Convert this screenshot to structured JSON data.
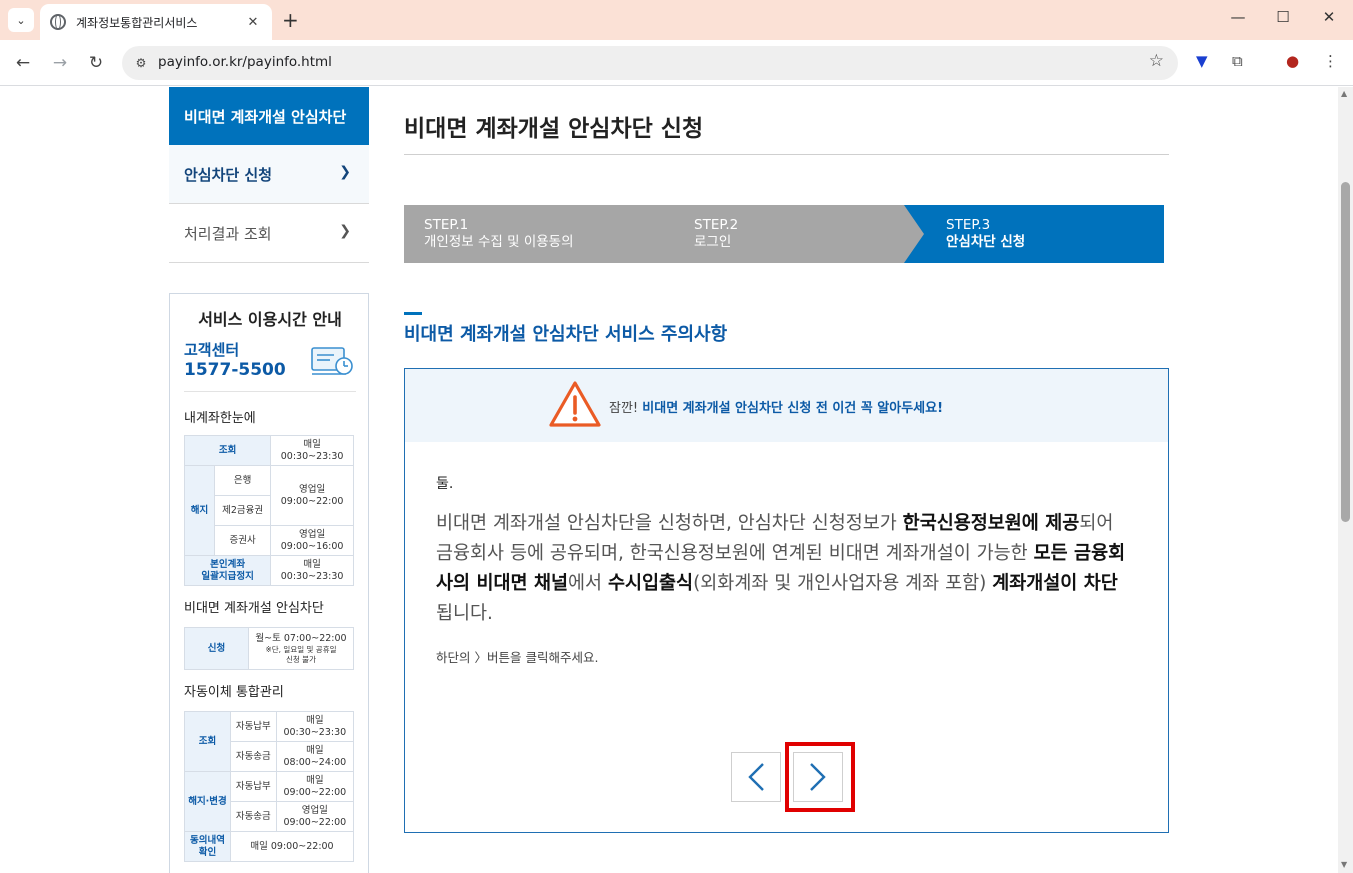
{
  "browser": {
    "tab_title": "계좌정보통합관리서비스",
    "url": "payinfo.or.kr/payinfo.html"
  },
  "sidebar": {
    "header": "비대면 계좌개설 안심차단",
    "items": [
      {
        "label": "안심차단 신청",
        "active": true
      },
      {
        "label": "처리결과 조회",
        "active": false
      }
    ]
  },
  "service_info": {
    "title": "서비스 이용시간 안내",
    "call_center_label": "고객센터",
    "call_center_phone": "1577-5500",
    "sections": [
      {
        "title": "내계좌한눈에",
        "rows": {
          "inquiry": "조회",
          "inquiry_time": "매일\n00:30~23:30",
          "cancel": "해지",
          "bank": "은행",
          "bank_time": "영업일\n09:00~22:00",
          "secondary": "제2금융권",
          "securities": "증권사",
          "securities_time": "영업일\n09:00~16:00",
          "own_account": "본인계좌\n일괄지급정지",
          "own_account_time": "매일\n00:30~23:30"
        }
      },
      {
        "title": "비대면 계좌개설 안심차단",
        "rows": {
          "apply": "신청",
          "apply_time": "월~토 07:00~22:00",
          "apply_note": "※단, 일요일 및 공휴일\n신청 불가"
        }
      },
      {
        "title": "자동이체 통합관리",
        "rows": {
          "inquiry": "조회",
          "auto_pay": "자동납부",
          "auto_pay_time": "매일\n00:30~23:30",
          "auto_send": "자동송금",
          "auto_send_time": "매일\n08:00~24:00",
          "change": "해지·변경",
          "change_pay": "자동납부",
          "change_pay_time": "매일\n09:00~22:00",
          "change_send": "자동송금",
          "change_send_time": "영업일\n09:00~22:00",
          "consent": "동의내역\n확인",
          "consent_time": "매일 09:00~22:00"
        }
      }
    ]
  },
  "main": {
    "title": "비대면 계좌개설 안심차단 신청",
    "steps": [
      {
        "num": "STEP.1",
        "label": "개인정보 수집 및 이용동의",
        "active": false
      },
      {
        "num": "STEP.2",
        "label": "로그인",
        "active": false
      },
      {
        "num": "STEP.3",
        "label": "안심차단 신청",
        "active": true
      }
    ],
    "section_heading": "비대면 계좌개설 안심차단 서비스 주의사항",
    "notice": {
      "warn_prefix": "잠깐!",
      "warn_text": "비대면 계좌개설 안심차단 신청 전 이건 꼭 알아두세요!",
      "number": "둘.",
      "body_1": "비대면 계좌개설 안심차단을 신청하면, 안심차단 신청정보가 ",
      "body_b1": "한국신용정보원에 제공",
      "body_2": "되어 금융회사 등에 공유되며, 한국신용정보원에 연계된 비대면 계좌개설이 가능한 ",
      "body_b2": "모든 금융회사의 비대면 채널",
      "body_3": "에서 ",
      "body_b3": "수시입출식",
      "body_4": "(외화계좌 및 개인사업자용 계좌 포함) ",
      "body_b4": "계좌개설이 차단",
      "body_5": "됩니다.",
      "hint": "하단의 〉버튼을 클릭해주세요."
    }
  },
  "colors": {
    "primary": "#0072bc",
    "step_inactive": "#a6a6a6",
    "highlight": "#e00000",
    "warning": "#ea5b25"
  }
}
